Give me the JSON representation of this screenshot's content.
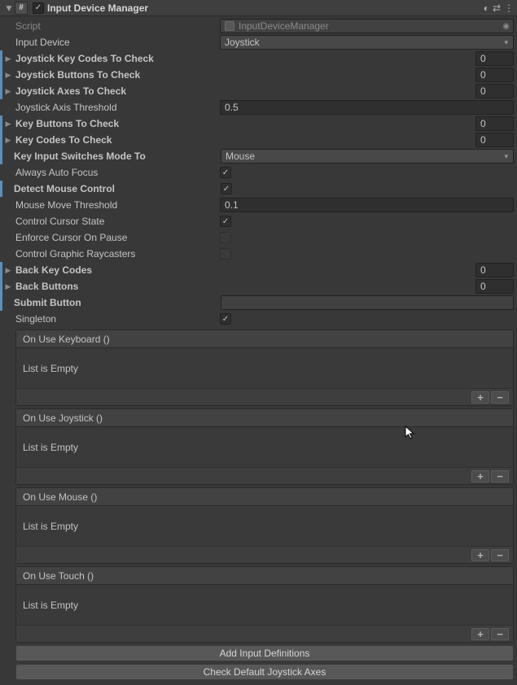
{
  "header": {
    "title": "Input Device Manager"
  },
  "rows": {
    "script_label": "Script",
    "script_value": "InputDeviceManager",
    "input_device_label": "Input Device",
    "input_device_value": "Joystick",
    "joystick_key_codes_label": "Joystick Key Codes To Check",
    "joystick_key_codes_count": "0",
    "joystick_buttons_label": "Joystick Buttons To Check",
    "joystick_buttons_count": "0",
    "joystick_axes_label": "Joystick Axes To Check",
    "joystick_axes_count": "0",
    "joystick_axis_threshold_label": "Joystick Axis Threshold",
    "joystick_axis_threshold_value": "0.5",
    "key_buttons_label": "Key Buttons To Check",
    "key_buttons_count": "0",
    "key_codes_label": "Key Codes To Check",
    "key_codes_count": "0",
    "key_input_switches_label": "Key Input Switches Mode To",
    "key_input_switches_value": "Mouse",
    "always_auto_focus_label": "Always Auto Focus",
    "detect_mouse_label": "Detect Mouse Control",
    "mouse_move_threshold_label": "Mouse Move Threshold",
    "mouse_move_threshold_value": "0.1",
    "control_cursor_state_label": "Control Cursor State",
    "enforce_cursor_pause_label": "Enforce Cursor On Pause",
    "control_raycasters_label": "Control Graphic Raycasters",
    "back_key_codes_label": "Back Key Codes",
    "back_key_codes_count": "0",
    "back_buttons_label": "Back Buttons",
    "back_buttons_count": "0",
    "submit_button_label": "Submit Button",
    "submit_button_value": "",
    "singleton_label": "Singleton"
  },
  "events": {
    "keyboard": {
      "title": "On Use Keyboard ()",
      "empty": "List is Empty"
    },
    "joystick": {
      "title": "On Use Joystick ()",
      "empty": "List is Empty"
    },
    "mouse": {
      "title": "On Use Mouse ()",
      "empty": "List is Empty"
    },
    "touch": {
      "title": "On Use Touch ()",
      "empty": "List is Empty"
    }
  },
  "buttons": {
    "add_input_defs": "Add Input Definitions",
    "check_default_axes": "Check Default Joystick Axes"
  },
  "icons": {
    "plus": "+",
    "minus": "−"
  }
}
